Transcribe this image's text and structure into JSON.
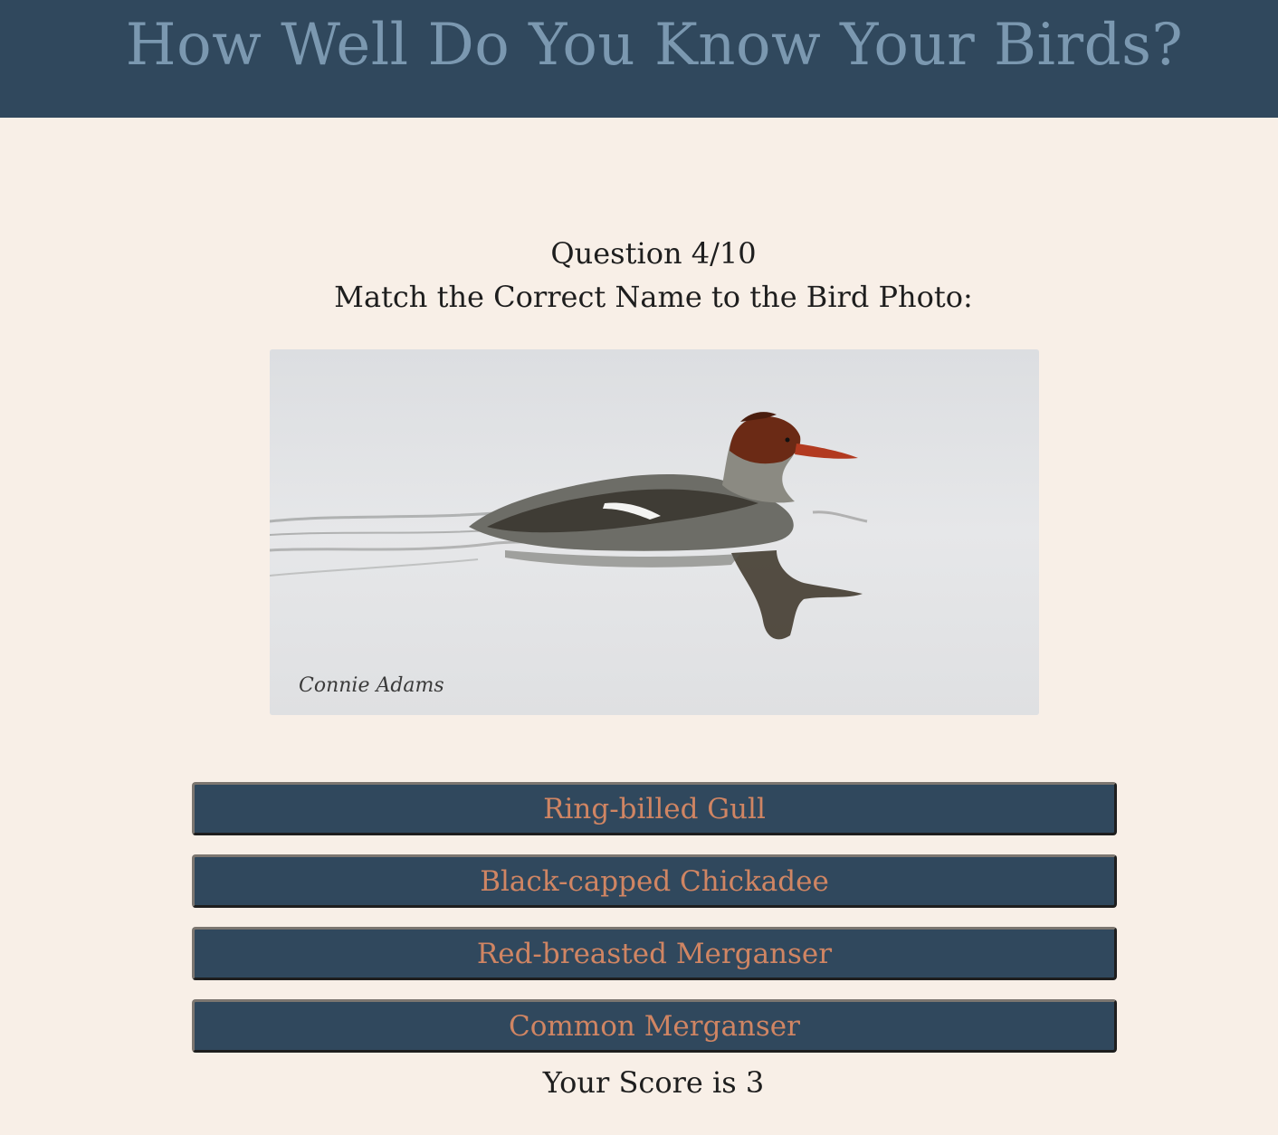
{
  "header": {
    "title": "How Well Do You Know Your Birds?"
  },
  "quiz": {
    "question_counter": "Question 4/10",
    "prompt": "Match the Correct Name to the Bird Photo:",
    "photo_watermark": "Connie Adams",
    "answers": [
      "Ring-billed Gull",
      "Black-capped Chickadee",
      "Red-breasted Merganser",
      "Common Merganser"
    ],
    "score_text": "Your Score is 3"
  },
  "colors": {
    "page_background": "#f8efe7",
    "header_background": "#30485d",
    "title_text": "#7b98b0",
    "button_background": "#30485d",
    "button_text": "#d08563"
  }
}
